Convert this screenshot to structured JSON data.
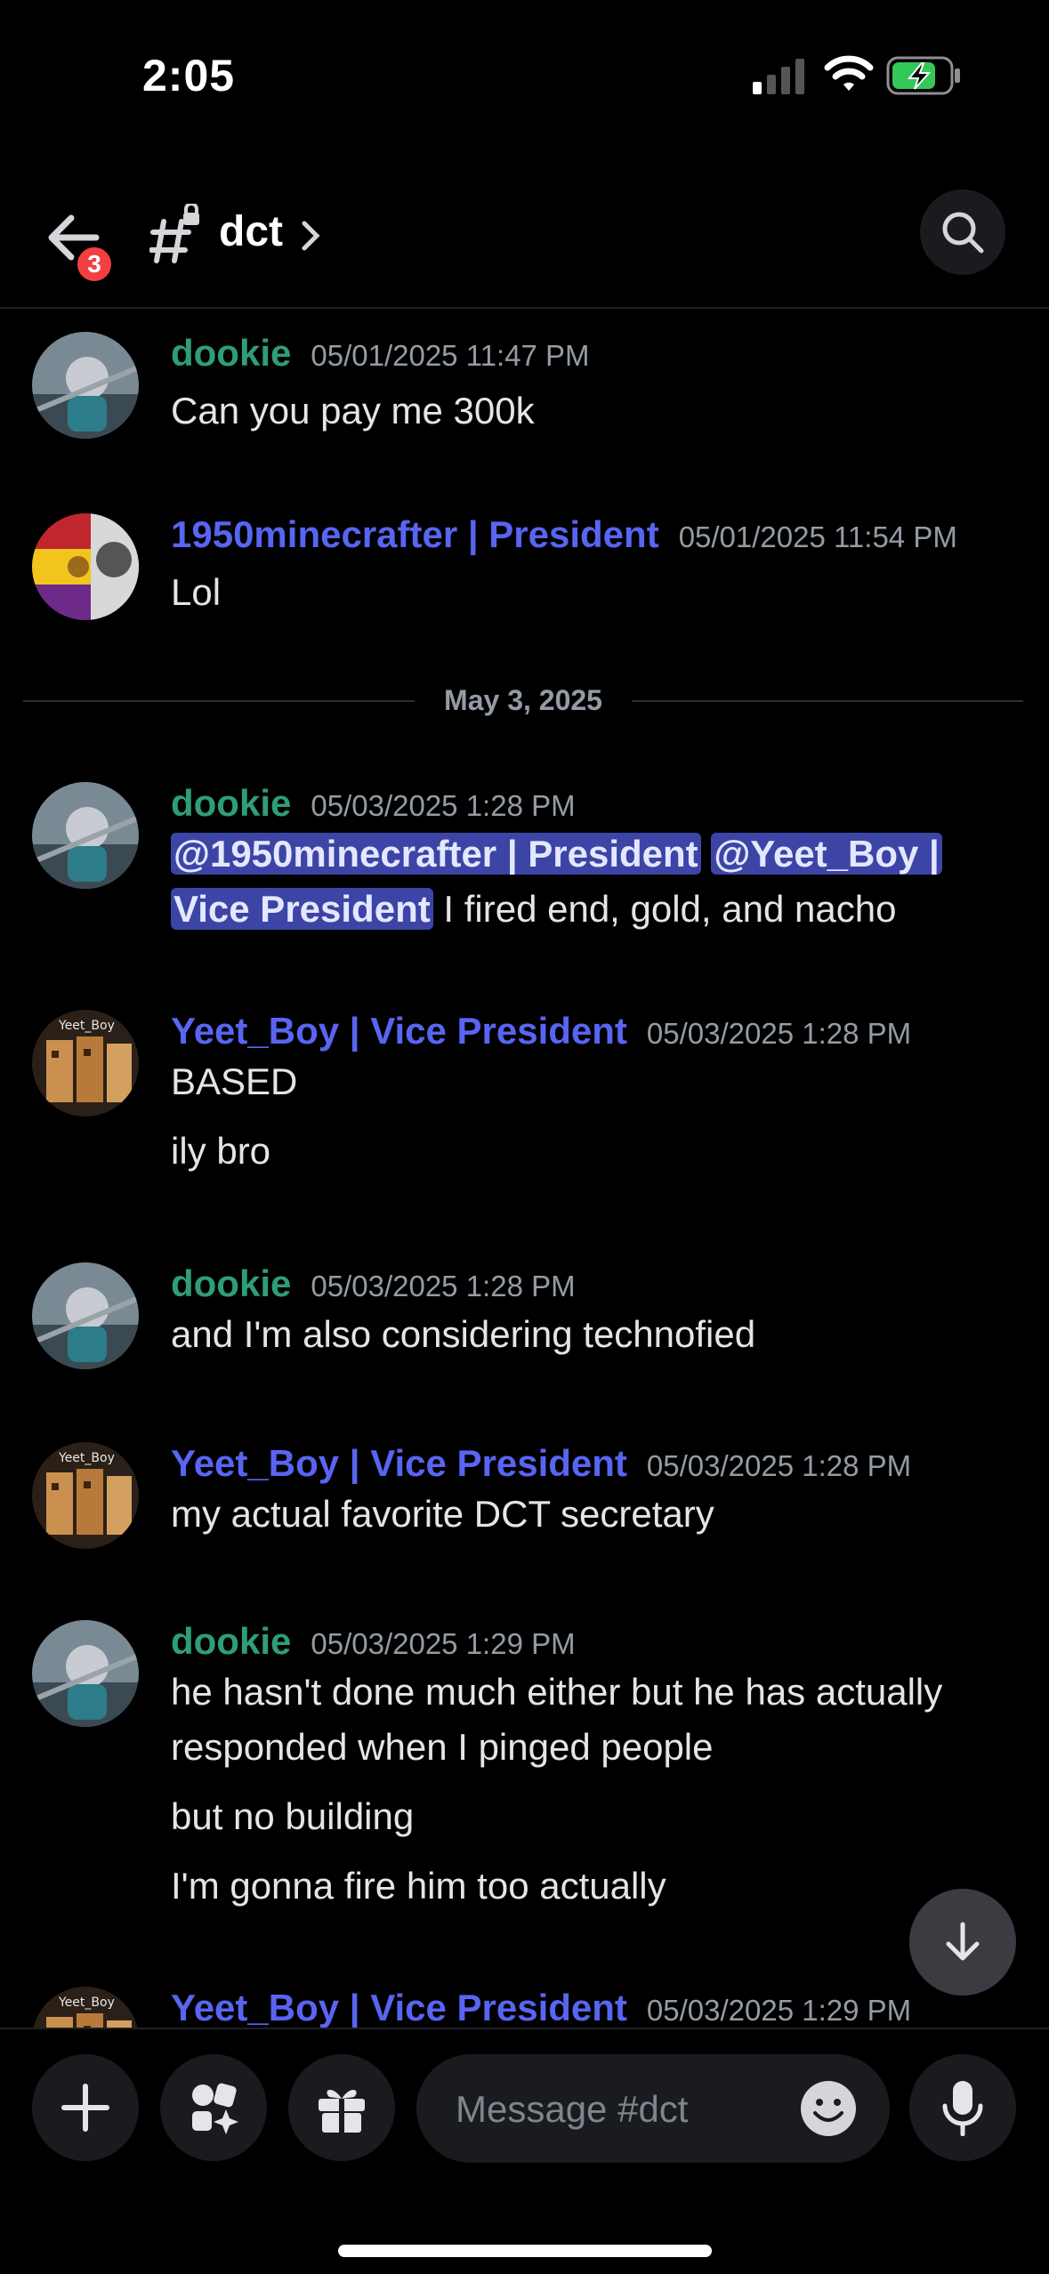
{
  "status": {
    "time": "2:05"
  },
  "header": {
    "badge_count": "3",
    "channel": "dct"
  },
  "messages": [
    {
      "author": "dookie",
      "color": "green",
      "timestamp": "05/01/2025 11:47 PM",
      "lines": [
        "Can you pay me 300k"
      ]
    },
    {
      "author": "1950minecrafter | President",
      "color": "purple",
      "timestamp": "05/01/2025 11:54 PM",
      "lines": [
        "Lol"
      ]
    },
    {
      "divider": "May 3, 2025"
    },
    {
      "author": "dookie",
      "color": "green",
      "timestamp": "05/03/2025 1:28 PM",
      "mentions": [
        "@1950minecrafter | President",
        "@Yeet_Boy |",
        "Vice President"
      ],
      "mention_tail": " I fired end, gold, and nacho"
    },
    {
      "author": "Yeet_Boy | Vice President",
      "color": "purple",
      "timestamp": "05/03/2025 1:28 PM",
      "lines": [
        "BASED",
        "ily bro"
      ]
    },
    {
      "author": "dookie",
      "color": "green",
      "timestamp": "05/03/2025 1:28 PM",
      "lines": [
        "and I'm also considering technofied"
      ]
    },
    {
      "author": "Yeet_Boy | Vice President",
      "color": "purple",
      "timestamp": "05/03/2025 1:28 PM",
      "lines": [
        "my actual favorite DCT secretary"
      ]
    },
    {
      "author": "dookie",
      "color": "green",
      "timestamp": "05/03/2025 1:29 PM",
      "lines": [
        "he hasn't done much either but he has actually",
        "responded when I pinged people",
        "but no building",
        "I'm gonna fire him too actually"
      ]
    },
    {
      "author": "Yeet_Boy | Vice President",
      "color": "purple",
      "timestamp": "05/03/2025 1:29 PM",
      "lines": []
    }
  ],
  "avatar_badge_text": "Yeet_Boy",
  "composer": {
    "placeholder": "Message #dct"
  },
  "colors": {
    "green_name": "#2e9e78",
    "purple_name": "#5865f2",
    "mention_bg": "#3c45a5",
    "badge": "#f23f42"
  }
}
